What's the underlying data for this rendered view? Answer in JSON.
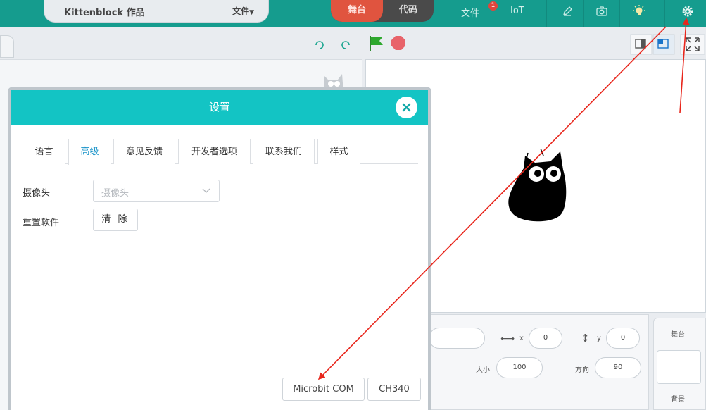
{
  "topbar": {
    "project_title": "Kittenblock 作品",
    "file_menu": "文件",
    "mode_stage": "舞台",
    "mode_code": "代码",
    "files_link": "文件",
    "files_badge": "1",
    "iot_link": "IoT",
    "icons": [
      "pencil-icon",
      "camera-icon",
      "lightbulb-icon",
      "gear-icon"
    ]
  },
  "stage_controls": {
    "icons": [
      "undo-icon",
      "redo-icon",
      "green-flag-icon",
      "stop-icon",
      "small-stage-icon",
      "large-stage-icon",
      "fullscreen-icon"
    ]
  },
  "sprite_info": {
    "x_label": "x",
    "x_value": "0",
    "y_label": "y",
    "y_value": "0",
    "size_label": "大小",
    "size_value": "100",
    "direction_label": "方向",
    "direction_value": "90"
  },
  "stage_panel": {
    "title": "舞台",
    "backdrop_label": "背景"
  },
  "modal": {
    "title": "设置",
    "tabs": [
      {
        "label": "语言"
      },
      {
        "label": "高级"
      },
      {
        "label": "意见反馈"
      },
      {
        "label": "开发者选项"
      },
      {
        "label": "联系我们"
      },
      {
        "label": "样式"
      }
    ],
    "active_tab": "高级",
    "camera_label": "摄像头",
    "camera_placeholder": "摄像头",
    "reset_label": "重置软件",
    "clear_button": "清 除",
    "microbit_button": "Microbit COM",
    "ch340_button": "CH340"
  },
  "colors": {
    "topbar": "#159c8e",
    "modal_header": "#13c4c4",
    "stage_mode": "#e0543f",
    "active_tab": "#1a94c9",
    "annotation_arrow": "#e8261c"
  }
}
